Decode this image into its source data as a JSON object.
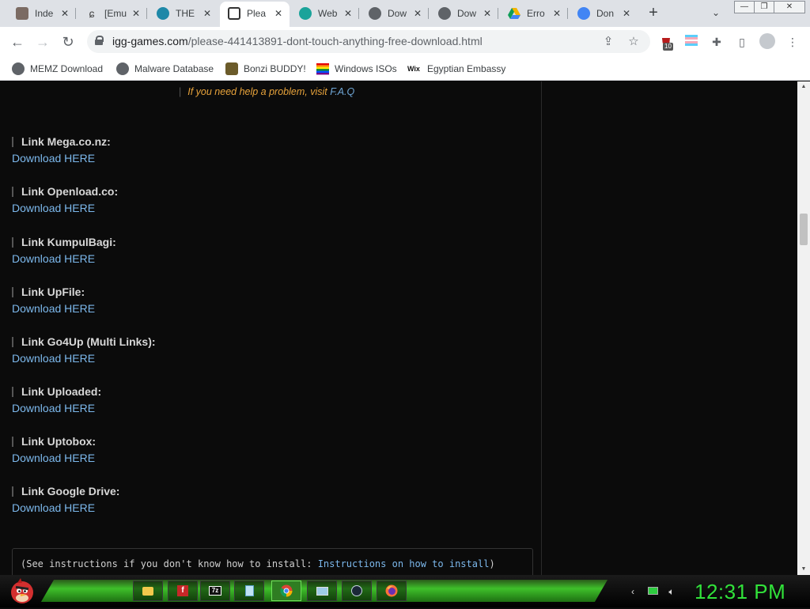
{
  "tabs": [
    {
      "title": "Inde",
      "icon": "page-favicon-icon",
      "color": "#7b6b63"
    },
    {
      "title": "[Emu",
      "icon": "emulator-favicon-icon",
      "color": "#444"
    },
    {
      "title": "THE",
      "icon": "circle-favicon-icon",
      "color": "#1e88a8"
    },
    {
      "title": "Plea",
      "icon": "igg-favicon-icon",
      "color": "#333",
      "active": true
    },
    {
      "title": "Web",
      "icon": "web-favicon-icon",
      "color": "#1aa39a"
    },
    {
      "title": "Dow",
      "icon": "globe-favicon-icon",
      "color": "#5f6368"
    },
    {
      "title": "Dow",
      "icon": "globe-favicon-icon",
      "color": "#5f6368"
    },
    {
      "title": "Erro",
      "icon": "drive-favicon-icon",
      "color": "#f4b400"
    },
    {
      "title": "Don",
      "icon": "google-favicon-icon",
      "color": "#4285f4"
    }
  ],
  "toolbar": {
    "url_host": "igg-games.com",
    "url_path": "/please-441413891-dont-touch-anything-free-download.html",
    "extension_badge": "10"
  },
  "bookmarks": [
    {
      "label": "MEMZ Download",
      "icon": "globe-icon"
    },
    {
      "label": "Malware Database",
      "icon": "globe-icon"
    },
    {
      "label": "Bonzi BUDDY!",
      "icon": "bonzi-icon"
    },
    {
      "label": "Windows ISOs",
      "icon": "rainbow-flag-icon"
    },
    {
      "label": "Egyptian Embassy",
      "icon": "wix-icon"
    }
  ],
  "page": {
    "help_text": "If you need help a problem, visit ",
    "help_link": "F.A.Q",
    "links": [
      {
        "label": "Link Mega.co.nz:",
        "download": "Download HERE"
      },
      {
        "label": "Link Openload.co:",
        "download": "Download HERE"
      },
      {
        "label": "Link KumpulBagi:",
        "download": "Download HERE"
      },
      {
        "label": "Link UpFile:",
        "download": "Download HERE"
      },
      {
        "label": "Link Go4Up (Multi Links):",
        "download": "Download HERE"
      },
      {
        "label": "Link Uploaded:",
        "download": "Download HERE"
      },
      {
        "label": "Link Uptobox:",
        "download": "Download HERE"
      },
      {
        "label": "Link Google Drive:",
        "download": "Download HERE"
      }
    ],
    "instructions_text": "(See instructions if you don't know how to install: ",
    "instructions_link": "Instructions on how to install",
    "instructions_close": ")"
  },
  "taskbar": {
    "clock": "12:31 PM",
    "apps": [
      "file-explorer-icon",
      "flash-icon",
      "7zip-icon",
      "notepad-icon",
      "chrome-icon",
      "remote-desktop-icon",
      "steam-icon",
      "firefox-icon"
    ]
  }
}
